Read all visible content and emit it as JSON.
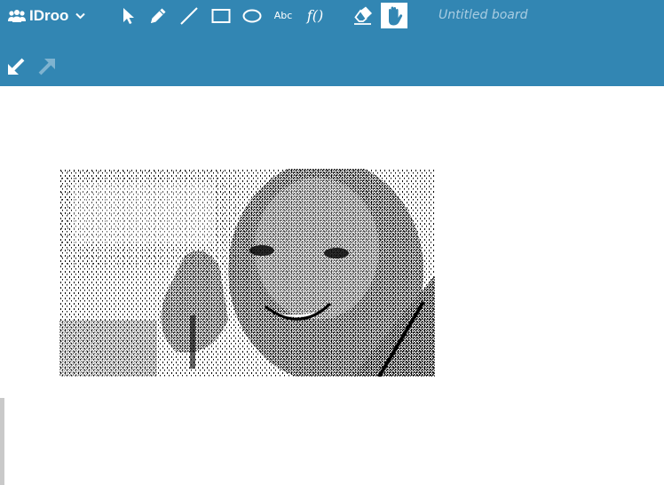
{
  "app": {
    "name": "IDroo",
    "brand_icon": "group-people-icon",
    "menu_icon": "chevron-down-icon"
  },
  "toolbar": {
    "tools": [
      {
        "id": "select",
        "icon": "pointer-arrow-icon"
      },
      {
        "id": "pencil",
        "icon": "pencil-icon"
      },
      {
        "id": "line",
        "icon": "line-icon"
      },
      {
        "id": "rectangle",
        "icon": "rectangle-icon"
      },
      {
        "id": "ellipse",
        "icon": "ellipse-icon"
      },
      {
        "id": "text",
        "icon": "text-icon",
        "label": "Abc"
      },
      {
        "id": "formula",
        "icon": "formula-icon",
        "label": "f()"
      },
      {
        "id": "eraser",
        "icon": "eraser-icon"
      },
      {
        "id": "pan",
        "icon": "hand-icon",
        "active": true
      }
    ]
  },
  "board": {
    "title_placeholder": "Untitled board"
  },
  "zoom": {
    "out_icon": "arrow-down-left-icon",
    "in_icon": "arrow-up-right-icon"
  },
  "colors": {
    "header": "#3286b3",
    "title_text": "#a9cde2",
    "disabled_icon": "#7fb3d0",
    "canvas": "#ffffff"
  },
  "canvas": {
    "image_description_icon": "dithered-photo-image"
  }
}
